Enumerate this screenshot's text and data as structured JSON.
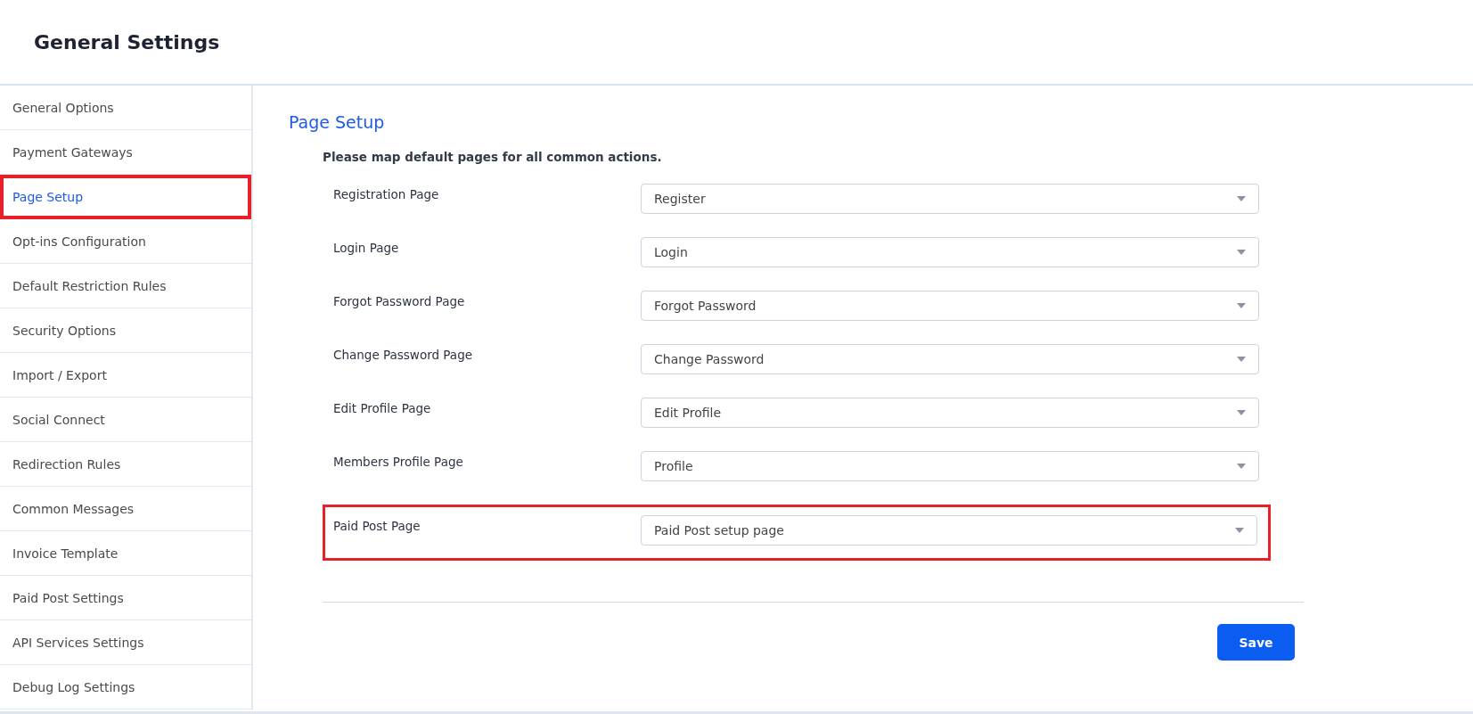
{
  "header": {
    "title": "General Settings"
  },
  "sidebar": {
    "items": [
      {
        "label": "General Options",
        "selected": false,
        "highlighted": false
      },
      {
        "label": "Payment Gateways",
        "selected": false,
        "highlighted": false
      },
      {
        "label": "Page Setup",
        "selected": true,
        "highlighted": true
      },
      {
        "label": "Opt-ins Configuration",
        "selected": false,
        "highlighted": false
      },
      {
        "label": "Default Restriction Rules",
        "selected": false,
        "highlighted": false
      },
      {
        "label": "Security Options",
        "selected": false,
        "highlighted": false
      },
      {
        "label": "Import / Export",
        "selected": false,
        "highlighted": false
      },
      {
        "label": "Social Connect",
        "selected": false,
        "highlighted": false
      },
      {
        "label": "Redirection Rules",
        "selected": false,
        "highlighted": false
      },
      {
        "label": "Common Messages",
        "selected": false,
        "highlighted": false
      },
      {
        "label": "Invoice Template",
        "selected": false,
        "highlighted": false
      },
      {
        "label": "Paid Post Settings",
        "selected": false,
        "highlighted": false
      },
      {
        "label": "API Services Settings",
        "selected": false,
        "highlighted": false
      },
      {
        "label": "Debug Log Settings",
        "selected": false,
        "highlighted": false
      }
    ]
  },
  "content": {
    "title": "Page Setup",
    "intro": "Please map default pages for all common actions.",
    "fields": [
      {
        "label": "Registration Page",
        "value": "Register",
        "highlighted": false
      },
      {
        "label": "Login Page",
        "value": "Login",
        "highlighted": false
      },
      {
        "label": "Forgot Password Page",
        "value": "Forgot Password",
        "highlighted": false
      },
      {
        "label": "Change Password Page",
        "value": "Change Password",
        "highlighted": false
      },
      {
        "label": "Edit Profile Page",
        "value": "Edit Profile",
        "highlighted": false
      },
      {
        "label": "Members Profile Page",
        "value": "Profile",
        "highlighted": false
      },
      {
        "label": "Paid Post Page",
        "value": "Paid Post setup page",
        "highlighted": true
      }
    ],
    "save_button": "Save"
  }
}
